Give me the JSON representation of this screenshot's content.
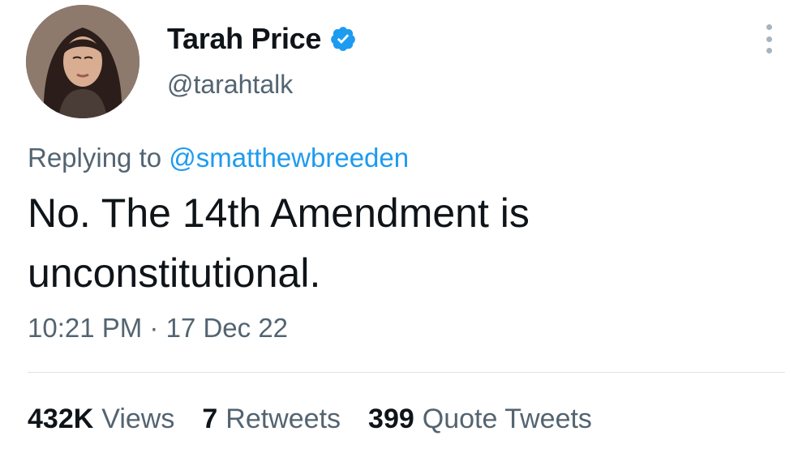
{
  "author": {
    "display_name": "Tarah Price",
    "handle": "@tarahtalk",
    "verified": true,
    "verified_icon": "verified-badge-icon",
    "verified_color": "#1d9bf0"
  },
  "reply": {
    "prefix": "Replying to",
    "target": "@smatthewbreeden"
  },
  "tweet": {
    "text_line1": "No. The 14th Amendment is",
    "text_line2": "unconstitutional.",
    "time": "10:21 PM",
    "separator": "·",
    "date": "17 Dec 22"
  },
  "stats": [
    {
      "value": "432K",
      "label": "Views"
    },
    {
      "value": "7",
      "label": "Retweets"
    },
    {
      "value": "399",
      "label": "Quote Tweets"
    }
  ],
  "colors": {
    "accent": "#1d9bf0",
    "text": "#0f1419",
    "secondary": "#536471"
  }
}
